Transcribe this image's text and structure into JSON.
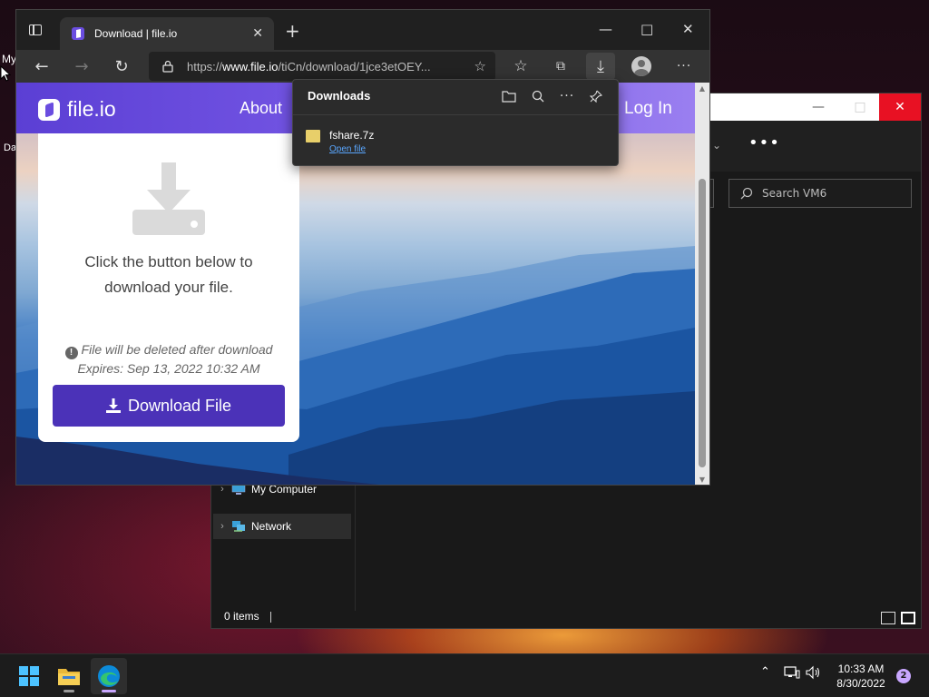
{
  "desktop": {
    "icon_label_1": "My",
    "icon_label_2": "Da"
  },
  "explorer": {
    "search_placeholder": "Search VM6",
    "more_label": "•••",
    "nav_items": [
      {
        "label": "My Computer"
      },
      {
        "label": "Network"
      }
    ],
    "status": "0 items"
  },
  "browser": {
    "tab_title": "Download | file.io",
    "url_prefix": "https://",
    "url_host": "www.file.io",
    "url_rest": "/tiCn/download/1jce3etOEY...",
    "downloads_panel": {
      "title": "Downloads",
      "file_name": "fshare.7z",
      "open_file_label": "Open file"
    }
  },
  "site": {
    "logo_text": "file.io",
    "nav_about": "About",
    "nav_login": "Log In",
    "message": "Click the button below to download your file.",
    "warning": "File will be deleted after download",
    "expires": "Expires: Sep 13, 2022 10:32 AM",
    "download_button": "Download File"
  },
  "taskbar": {
    "time": "10:33 AM",
    "date": "8/30/2022",
    "notification_count": "2"
  },
  "colors": {
    "brand_purple": "#5b3fd4",
    "download_button": "#4b32b8",
    "link_blue": "#5aa7ff",
    "windows_blue": "#4cc2ff"
  }
}
